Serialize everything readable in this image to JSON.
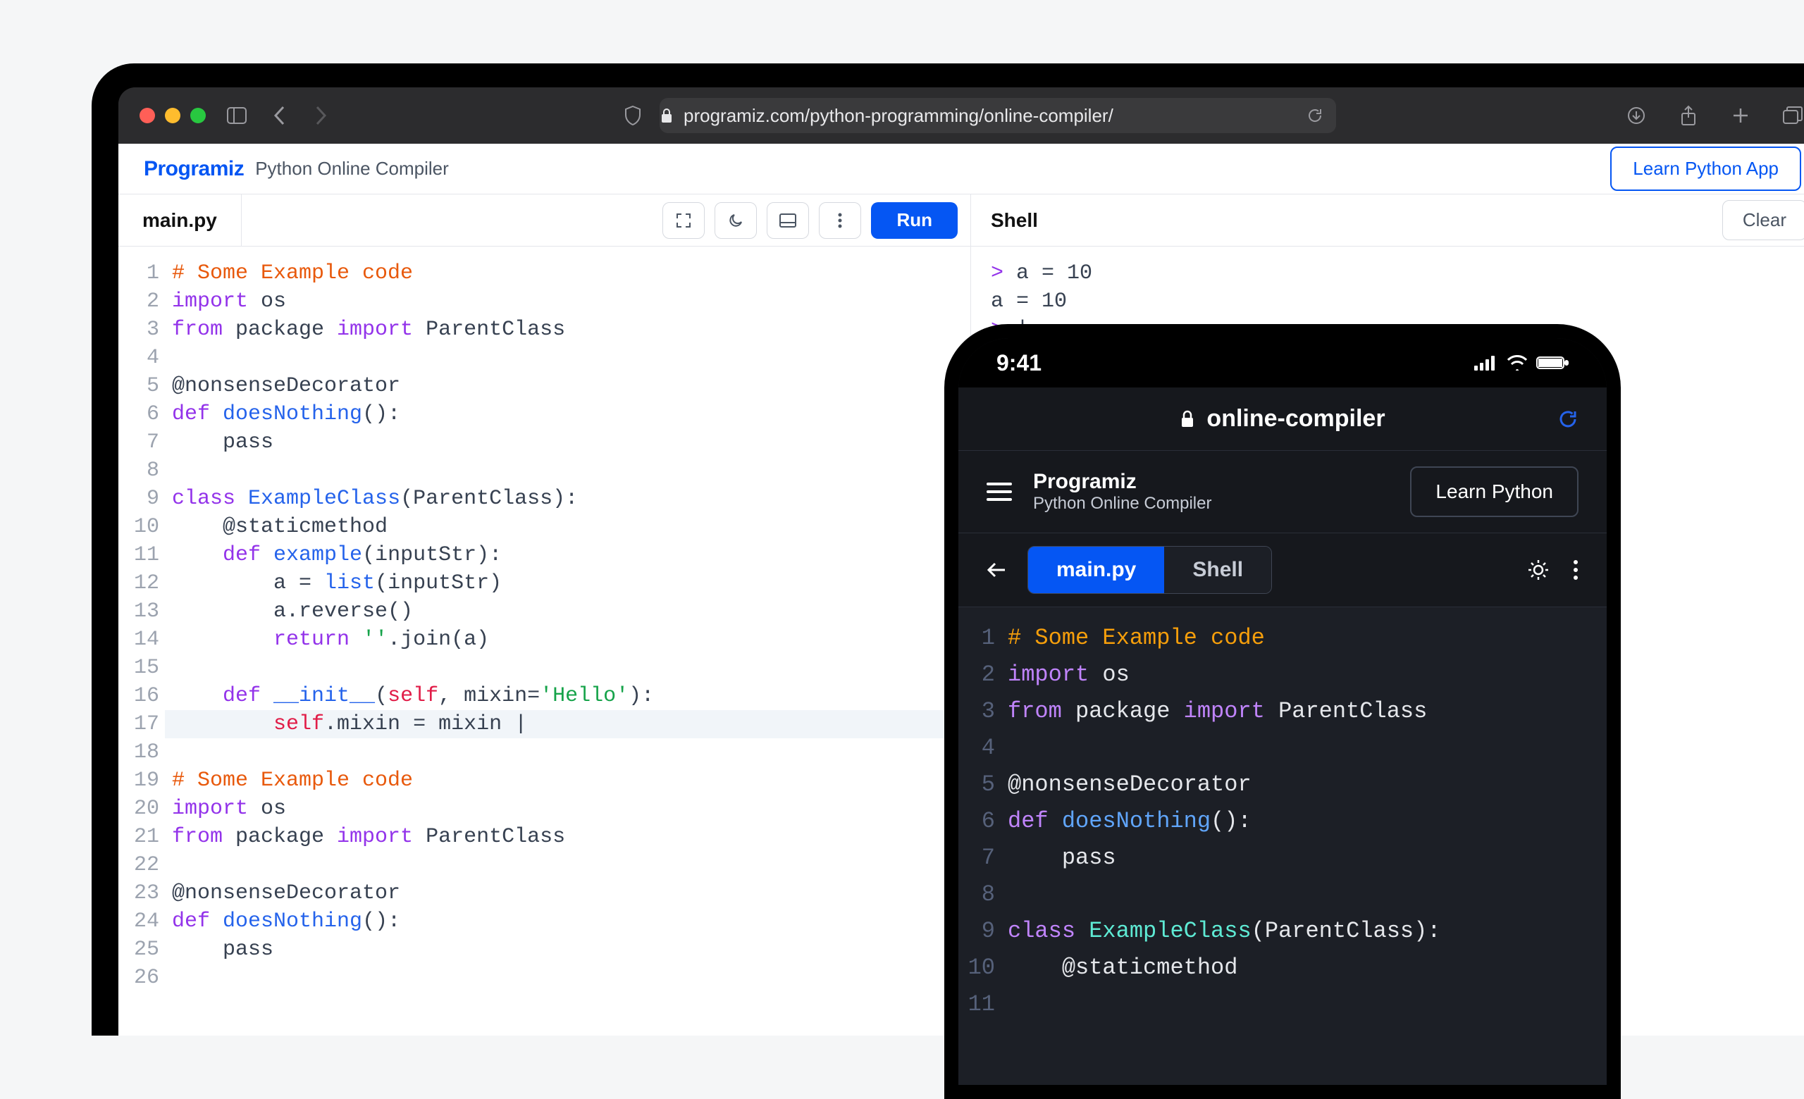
{
  "browser": {
    "url": "programiz.com/python-programming/online-compiler/"
  },
  "site": {
    "brand": "Programiz",
    "subtitle": "Python Online Compiler",
    "learn_button": "Learn Python App"
  },
  "editor": {
    "tab_label": "main.py",
    "run_label": "Run",
    "lines": [
      {
        "n": 1,
        "tokens": [
          [
            "comment",
            "# Some Example code"
          ]
        ]
      },
      {
        "n": 2,
        "tokens": [
          [
            "kw",
            "import"
          ],
          [
            "plain",
            " os"
          ]
        ]
      },
      {
        "n": 3,
        "tokens": [
          [
            "kw",
            "from"
          ],
          [
            "plain",
            " package "
          ],
          [
            "kw",
            "import"
          ],
          [
            "plain",
            " ParentClass"
          ]
        ]
      },
      {
        "n": 4,
        "tokens": []
      },
      {
        "n": 5,
        "tokens": [
          [
            "decorator",
            "@nonsenseDecorator"
          ]
        ]
      },
      {
        "n": 6,
        "tokens": [
          [
            "kw",
            "def "
          ],
          [
            "fn",
            "doesNothing"
          ],
          [
            "plain",
            "():"
          ]
        ]
      },
      {
        "n": 7,
        "tokens": [
          [
            "plain",
            "    pass"
          ]
        ]
      },
      {
        "n": 8,
        "tokens": []
      },
      {
        "n": 9,
        "tokens": [
          [
            "kw",
            "class "
          ],
          [
            "fn",
            "ExampleClass"
          ],
          [
            "plain",
            "(ParentClass):"
          ]
        ]
      },
      {
        "n": 10,
        "tokens": [
          [
            "plain",
            "    @staticmethod"
          ]
        ]
      },
      {
        "n": 11,
        "tokens": [
          [
            "plain",
            "    "
          ],
          [
            "kw",
            "def "
          ],
          [
            "fn",
            "example"
          ],
          [
            "plain",
            "(inputStr):"
          ]
        ]
      },
      {
        "n": 12,
        "tokens": [
          [
            "plain",
            "        a = "
          ],
          [
            "builtin",
            "list"
          ],
          [
            "plain",
            "(inputStr)"
          ]
        ]
      },
      {
        "n": 13,
        "tokens": [
          [
            "plain",
            "        a.reverse()"
          ]
        ]
      },
      {
        "n": 14,
        "tokens": [
          [
            "plain",
            "        "
          ],
          [
            "kw",
            "return"
          ],
          [
            "plain",
            " "
          ],
          [
            "str",
            "''"
          ],
          [
            "plain",
            ".join(a)"
          ]
        ]
      },
      {
        "n": 15,
        "tokens": []
      },
      {
        "n": 16,
        "tokens": [
          [
            "plain",
            "    "
          ],
          [
            "kw",
            "def "
          ],
          [
            "fn",
            "__init__"
          ],
          [
            "plain",
            "("
          ],
          [
            "self",
            "self"
          ],
          [
            "plain",
            ", mixin="
          ],
          [
            "str",
            "'Hello'"
          ],
          [
            "plain",
            "):"
          ]
        ]
      },
      {
        "n": 17,
        "hl": true,
        "tokens": [
          [
            "plain",
            "        "
          ],
          [
            "self",
            "self"
          ],
          [
            "plain",
            ".mixin = mixin |"
          ]
        ]
      },
      {
        "n": 18,
        "tokens": []
      },
      {
        "n": 19,
        "tokens": [
          [
            "comment",
            "# Some Example code"
          ]
        ]
      },
      {
        "n": 20,
        "tokens": [
          [
            "kw",
            "import"
          ],
          [
            "plain",
            " os"
          ]
        ]
      },
      {
        "n": 21,
        "tokens": [
          [
            "kw",
            "from"
          ],
          [
            "plain",
            " package "
          ],
          [
            "kw",
            "import"
          ],
          [
            "plain",
            " ParentClass"
          ]
        ]
      },
      {
        "n": 22,
        "tokens": []
      },
      {
        "n": 23,
        "tokens": [
          [
            "decorator",
            "@nonsenseDecorator"
          ]
        ]
      },
      {
        "n": 24,
        "tokens": [
          [
            "kw",
            "def "
          ],
          [
            "fn",
            "doesNothing"
          ],
          [
            "plain",
            "():"
          ]
        ]
      },
      {
        "n": 25,
        "tokens": [
          [
            "plain",
            "    pass"
          ]
        ]
      },
      {
        "n": 26,
        "tokens": []
      }
    ]
  },
  "shell": {
    "title": "Shell",
    "clear_label": "Clear",
    "lines": [
      {
        "prompt": true,
        "text": "a = 10"
      },
      {
        "prompt": false,
        "text": "a = 10"
      },
      {
        "prompt": true,
        "text": "|"
      }
    ]
  },
  "mobile": {
    "time": "9:41",
    "url_label": "online-compiler",
    "brand": "Programiz",
    "brand_sub": "Python Online Compiler",
    "learn_button": "Learn Python",
    "tabs": {
      "main": "main.py",
      "shell": "Shell"
    },
    "lines": [
      {
        "n": 1,
        "tokens": [
          [
            "comment",
            "# Some Example code"
          ]
        ]
      },
      {
        "n": 2,
        "tokens": [
          [
            "kw",
            "import"
          ],
          [
            "plain",
            " os"
          ]
        ]
      },
      {
        "n": 3,
        "tokens": [
          [
            "kw",
            "from"
          ],
          [
            "plain",
            " package "
          ],
          [
            "kw",
            "import"
          ],
          [
            "plain",
            " ParentClass"
          ]
        ]
      },
      {
        "n": 4,
        "tokens": []
      },
      {
        "n": 5,
        "tokens": [
          [
            "decorator",
            "@nonsenseDecorator"
          ]
        ]
      },
      {
        "n": 6,
        "tokens": [
          [
            "kw",
            "def "
          ],
          [
            "fn",
            "doesNothing"
          ],
          [
            "plain",
            "():"
          ]
        ]
      },
      {
        "n": 7,
        "tokens": [
          [
            "plain",
            "    pass"
          ]
        ]
      },
      {
        "n": 8,
        "tokens": []
      },
      {
        "n": 9,
        "tokens": [
          [
            "kw",
            "class "
          ],
          [
            "type",
            "ExampleClass"
          ],
          [
            "plain",
            "(ParentClass):"
          ]
        ]
      },
      {
        "n": 10,
        "tokens": [
          [
            "plain",
            "    @staticmethod"
          ]
        ]
      },
      {
        "n": 11,
        "tokens": []
      }
    ]
  }
}
